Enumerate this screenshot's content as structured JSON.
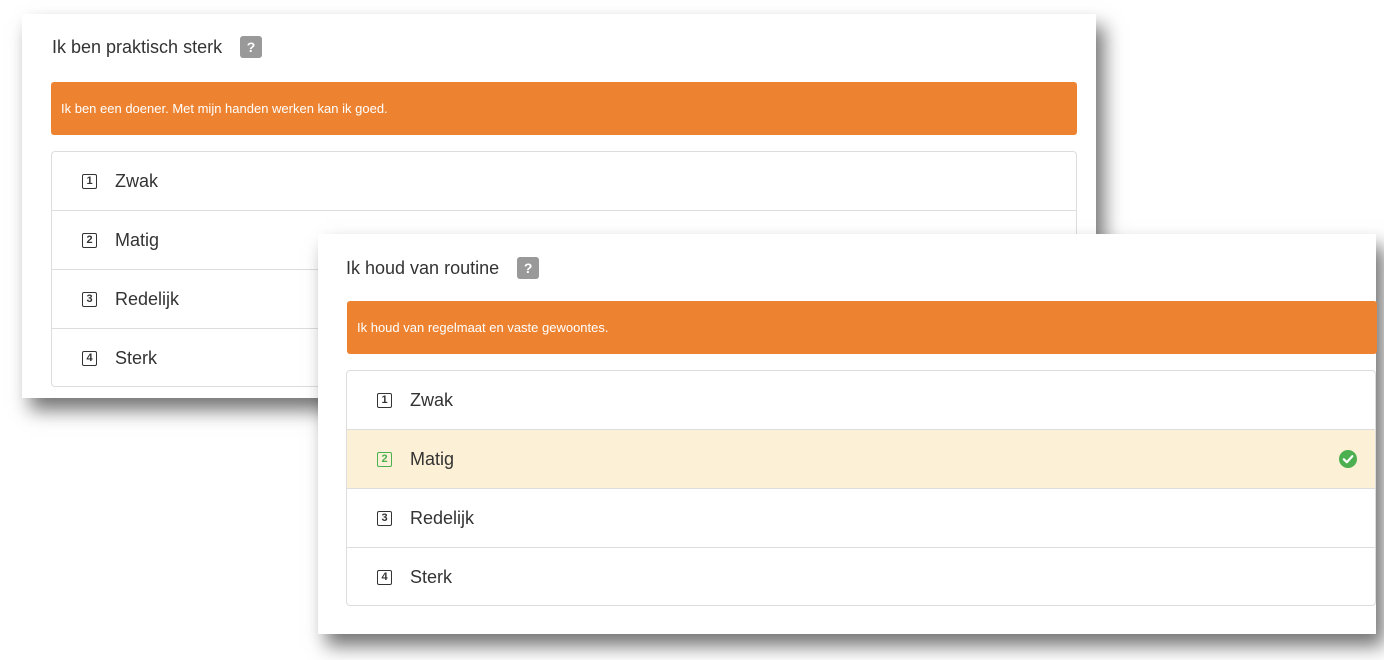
{
  "questions": [
    {
      "title": "Ik ben praktisch sterk",
      "help_label": "?",
      "description": "Ik ben een doener. Met mijn handen werken kan ik goed.",
      "options": [
        {
          "key": "1",
          "label": "Zwak"
        },
        {
          "key": "2",
          "label": "Matig"
        },
        {
          "key": "3",
          "label": "Redelijk"
        },
        {
          "key": "4",
          "label": "Sterk"
        }
      ]
    },
    {
      "title": "Ik houd van routine",
      "help_label": "?",
      "description": "Ik houd van regelmaat en vaste gewoontes.",
      "selected_option": "Matig",
      "options": [
        {
          "key": "1",
          "label": "Zwak"
        },
        {
          "key": "2",
          "label": "Matig"
        },
        {
          "key": "3",
          "label": "Redelijk"
        },
        {
          "key": "4",
          "label": "Sterk"
        }
      ]
    }
  ],
  "colors": {
    "alert_bg": "#ed8331",
    "selected_bg": "#fcf0d6",
    "selected_accent": "#4caf50",
    "help_badge_bg": "#999999"
  },
  "icons": {
    "selected_indicator": "check-circle-icon"
  }
}
